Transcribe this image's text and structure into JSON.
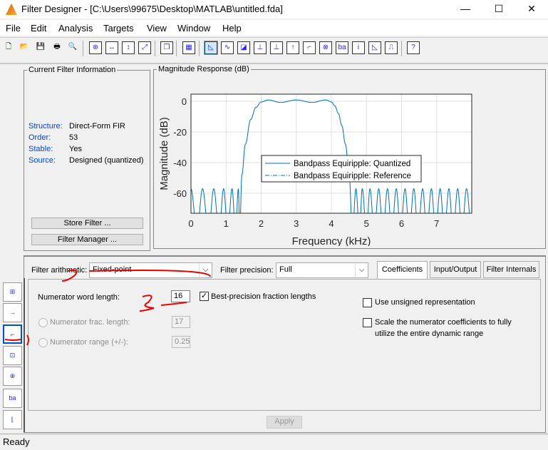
{
  "window": {
    "title": "Filter Designer - [C:\\Users\\99675\\Desktop\\MATLAB\\untitled.fda]",
    "minimize": "—",
    "maximize": "☐",
    "close": "✕"
  },
  "menu": [
    "File",
    "Edit",
    "Analysis",
    "Targets",
    "View",
    "Window",
    "Help"
  ],
  "toolbar": [
    "new-file-icon",
    "open-folder-icon",
    "save-icon",
    "print-icon",
    "print-preview-icon",
    "zoom-in-icon",
    "zoom-x-icon",
    "zoom-y-icon",
    "full-view-icon",
    "new-figure-icon",
    "legend-icon",
    "magnitude-response-icon",
    "phase-response-icon",
    "magnitude-phase-icon",
    "group-delay-icon",
    "phase-delay-icon",
    "impulse-response-icon",
    "step-response-icon",
    "pole-zero-icon",
    "filter-coefficients-icon",
    "filter-info-icon",
    "magnitude-estimate-icon",
    "roundoff-noise-icon",
    "whats-this-icon"
  ],
  "info": {
    "title": "Current Filter Information",
    "rows": [
      {
        "k": "Structure:",
        "v": "Direct-Form FIR"
      },
      {
        "k": "Order:",
        "v": "53"
      },
      {
        "k": "Stable:",
        "v": "Yes"
      },
      {
        "k": "Source:",
        "v": "Designed (quantized)"
      }
    ],
    "store": "Store Filter ...",
    "manager": "Filter Manager ..."
  },
  "plot": {
    "title": "Magnitude Response (dB)"
  },
  "chart_data": {
    "type": "line",
    "title": "",
    "xlabel": "Frequency (kHz)",
    "ylabel": "Magnitude (dB)",
    "xlim": [
      0,
      8
    ],
    "ylim": [
      -73,
      4.6
    ],
    "xticks": [
      0,
      1,
      2,
      3,
      4,
      5,
      6,
      7
    ],
    "yticks": [
      0,
      -20,
      -40,
      -60
    ],
    "grid": true,
    "legend_position": "center",
    "series": [
      {
        "name": "Bandpass Equiripple: Quantized",
        "style": "solid",
        "color": "#0072bd",
        "x": [
          0,
          0.17,
          0.33,
          0.5,
          0.65,
          0.8,
          0.93,
          1.05,
          1.17,
          1.27,
          1.35,
          1.39,
          1.45,
          1.55,
          1.7,
          1.85,
          2.0,
          2.2,
          2.55,
          3.0,
          3.45,
          3.85,
          4.0,
          4.1,
          4.2,
          4.3,
          4.4,
          4.5,
          4.6,
          4.7,
          4.8,
          4.88,
          5.0,
          5.1,
          5.22,
          5.35,
          5.47,
          5.6,
          5.72,
          5.85,
          5.97,
          6.1,
          6.22,
          6.35,
          6.47,
          6.6,
          6.72,
          6.85,
          6.97,
          7.1,
          7.22,
          7.35,
          7.47,
          7.6,
          7.72,
          7.85,
          8.0
        ],
        "y": [
          -57,
          -85,
          -57,
          -85,
          -57,
          -85,
          -57,
          -85,
          -57,
          -85,
          -57,
          -85,
          -48,
          -28,
          -12,
          -4,
          -0.5,
          0.8,
          -0.8,
          0.8,
          -0.8,
          0.8,
          -0.5,
          -3,
          -8,
          -16,
          -28,
          -45,
          -85,
          -57,
          -85,
          -57,
          -85,
          -57,
          -85,
          -57,
          -85,
          -57,
          -85,
          -57,
          -85,
          -57,
          -85,
          -57,
          -85,
          -57,
          -85,
          -57,
          -85,
          -57,
          -85,
          -57,
          -85,
          -57,
          -85,
          -57,
          -85
        ]
      },
      {
        "name": "Bandpass Equiripple: Reference",
        "style": "dashdot",
        "color": "#0072bd"
      }
    ]
  },
  "bottom": {
    "arith_label": "Filter arithmetic:",
    "arith_value": "Fixed-point",
    "prec_label": "Filter precision:",
    "prec_value": "Full",
    "tabs": [
      "Coefficients",
      "Input/Output",
      "Filter Internals"
    ],
    "word_label": "Numerator word length:",
    "word_value": "16",
    "best_label": "Best-precision fraction lengths",
    "best_checked": true,
    "frac_label": "Numerator frac. length:",
    "frac_value": "17",
    "range_label": "Numerator range (+/-):",
    "range_value": "0.25",
    "unsigned_label": "Use unsigned representation",
    "scale_label1": "Scale the numerator coefficients to fully",
    "scale_label2": "utilize the entire dynamic range",
    "apply": "Apply"
  },
  "annotations": [
    "1",
    "2",
    "3"
  ],
  "status": "Ready"
}
